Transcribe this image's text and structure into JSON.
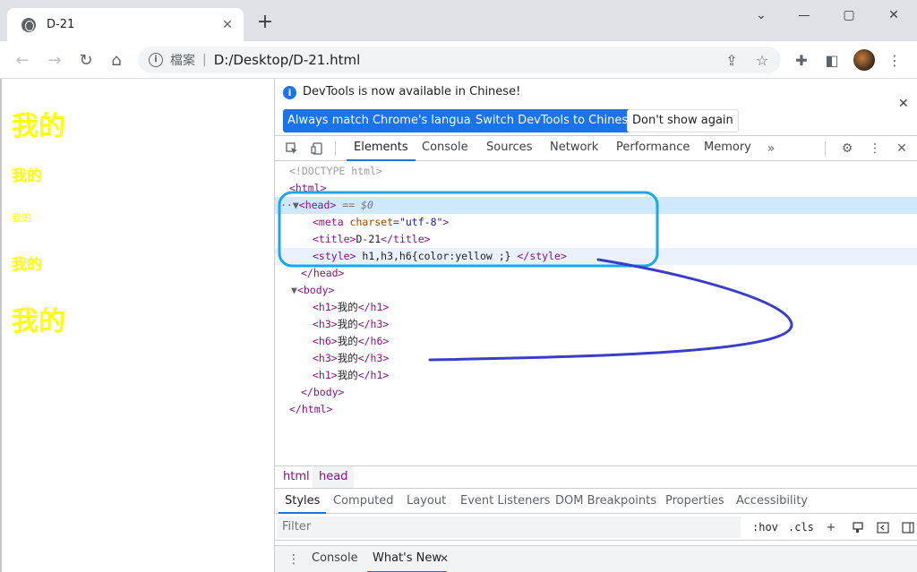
{
  "tab": {
    "title": "D-21",
    "close": "✕",
    "new_tab": "+"
  },
  "window": {
    "minimize": "⌄",
    "restore": "▢",
    "close": "✕",
    "tabsearch": "⌄"
  },
  "toolbar": {
    "back": "←",
    "forward": "→",
    "reload": "↻",
    "home": "⌂",
    "info": "i",
    "chip": "檔案",
    "separator": "|",
    "url": "D:/Desktop/D-21.html",
    "share": "⇪",
    "bookmark": "☆",
    "extensions": "✚",
    "sidepanel": "◧",
    "menu": "⋮"
  },
  "page": {
    "headings": [
      "我的",
      "我的",
      "我的",
      "我的",
      "我的"
    ]
  },
  "devtools": {
    "infobar": {
      "message": "DevTools is now available in Chinese!",
      "btn_match": "Always match Chrome's language",
      "btn_switch": "Switch DevTools to Chinese",
      "btn_dismiss": "Don't show again",
      "close": "✕"
    },
    "tabs": [
      "Elements",
      "Console",
      "Sources",
      "Network",
      "Performance",
      "Memory"
    ],
    "more": "»",
    "gear": "⚙",
    "kebab": "⋮",
    "close": "✕",
    "dom": {
      "doctype": "<!DOCTYPE html>",
      "html_open": "<html>",
      "head_open": "<head>",
      "eq": "== $0",
      "meta_tag_open": "<meta ",
      "meta_attr": "charset",
      "meta_val": "\"utf-8\"",
      "meta_close": ">",
      "title_open": "<title>",
      "title_text": "D-21",
      "title_close": "</title>",
      "style_open": "<style>",
      "style_text": " h1,h3,h6{color:yellow ;} ",
      "style_close": "</style>",
      "head_close": "</head>",
      "body_open": "<body>",
      "body_children": [
        {
          "open": "<h1>",
          "text": "我的",
          "close": "</h1>"
        },
        {
          "open": "<h3>",
          "text": "我的",
          "close": "</h3>"
        },
        {
          "open": "<h6>",
          "text": "我的",
          "close": "</h6>"
        },
        {
          "open": "<h3>",
          "text": "我的",
          "close": "</h3>"
        },
        {
          "open": "<h1>",
          "text": "我的",
          "close": "</h1>"
        }
      ],
      "body_close": "</body>",
      "html_close": "</html>"
    },
    "breadcrumbs": [
      "html",
      "head"
    ],
    "subtabs": [
      "Styles",
      "Computed",
      "Layout",
      "Event Listeners",
      "DOM Breakpoints",
      "Properties",
      "Accessibility"
    ],
    "filter_placeholder": "Filter",
    "hov": ":hov",
    "cls": ".cls",
    "drawer_tabs": [
      "Console",
      "What's New"
    ],
    "drawer_close": "✕"
  },
  "colors": {
    "accent": "#1a73e8",
    "heading": "#ffff00",
    "annotation_box": "#1ea7e8",
    "annotation_stroke": "#3a3dc8"
  }
}
